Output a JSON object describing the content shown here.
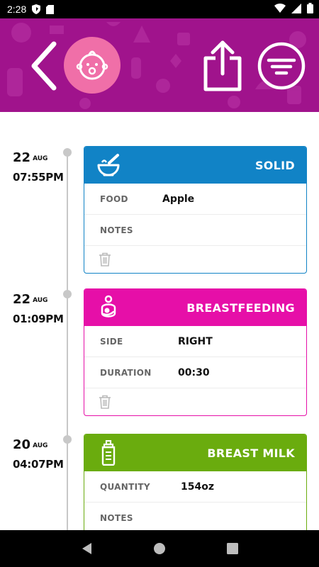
{
  "status_bar": {
    "time": "2:28",
    "icons": [
      "shield-icon",
      "sd-card-icon",
      "wifi-icon",
      "signal-icon",
      "battery-icon"
    ]
  },
  "header": {
    "background": "#a0138c",
    "avatar_color": "#f06fa8",
    "icons": [
      "back-icon",
      "baby-face-icon",
      "share-icon",
      "filter-icon"
    ]
  },
  "entries": [
    {
      "day": "22",
      "month": "AUG",
      "time": "07:55PM",
      "category": "SOLID",
      "color": "#1183c6",
      "icon": "bowl-icon",
      "fields": [
        {
          "label": "FOOD",
          "value": "Apple"
        },
        {
          "label": "NOTES",
          "value": ""
        }
      ]
    },
    {
      "day": "22",
      "month": "AUG",
      "time": "01:09PM",
      "category": "BREASTFEEDING",
      "color": "#e60fa8",
      "icon": "breastfeeding-icon",
      "fields": [
        {
          "label": "SIDE",
          "value": "RIGHT"
        },
        {
          "label": "DURATION",
          "value": "00:30"
        }
      ]
    },
    {
      "day": "20",
      "month": "AUG",
      "time": "04:07PM",
      "category": "BREAST MILK",
      "color": "#6aac0e",
      "icon": "bottle-icon",
      "fields": [
        {
          "label": "QUANTITY",
          "value": "154oz"
        },
        {
          "label": "NOTES",
          "value": ""
        }
      ]
    }
  ],
  "nav_bar": {
    "icons": [
      "nav-back-icon",
      "nav-home-icon",
      "nav-recents-icon"
    ]
  }
}
